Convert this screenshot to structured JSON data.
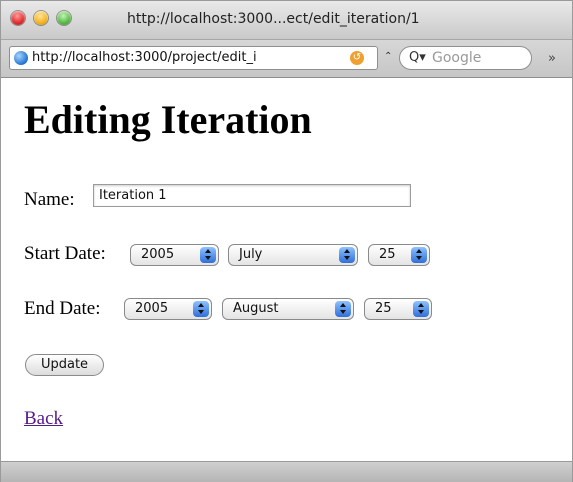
{
  "window": {
    "title": "http://localhost:3000...ect/edit_iteration/1"
  },
  "toolbar": {
    "url": "http://localhost:3000/project/edit_i",
    "search_placeholder": "Google",
    "search_icon_glyph": "Q▾",
    "overflow_glyph": "»"
  },
  "page": {
    "heading": "Editing Iteration",
    "name_label": "Name:",
    "name_value": "Iteration 1",
    "start_label": "Start Date:",
    "start_year": "2005",
    "start_month": "July",
    "start_day": "25",
    "end_label": "End Date:",
    "end_year": "2005",
    "end_month": "August",
    "end_day": "25",
    "update_label": "Update",
    "back_label": "Back"
  },
  "colors": {
    "link_visited": "#551a8b",
    "select_button": "#2f6fd9"
  }
}
